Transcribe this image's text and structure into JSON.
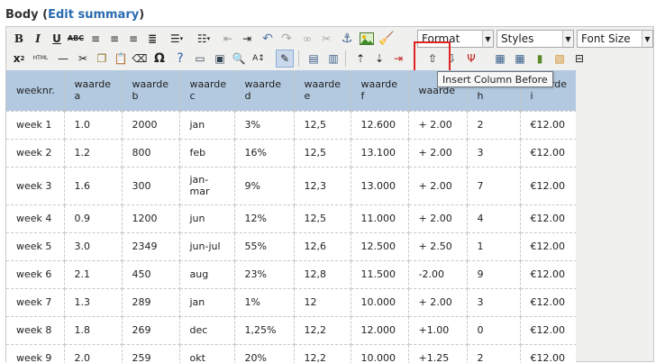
{
  "field": {
    "label": "Body",
    "open_paren": " (",
    "link": "Edit summary",
    "close_paren": ")"
  },
  "toolbar": {
    "format_value": "Format",
    "styles_value": "Styles",
    "fontsize_value": "Font Size",
    "tooltip": "Insert Column Before",
    "highlight_color": "#e02222"
  },
  "table": {
    "headers": [
      [
        "weeknr.",
        ""
      ],
      [
        "waarde",
        "a"
      ],
      [
        "waarde",
        "b"
      ],
      [
        "waarde",
        "c"
      ],
      [
        "waarde",
        "d"
      ],
      [
        "waarde",
        "e"
      ],
      [
        "waarde",
        "f"
      ],
      [
        "waarde",
        ""
      ],
      [
        "",
        "h"
      ],
      [
        "waarde",
        "i"
      ]
    ],
    "rows": [
      [
        "week 1",
        "1.0",
        "2000",
        "jan",
        "3%",
        "12,5",
        "12.600",
        "+ 2.00",
        "2",
        "€12.00"
      ],
      [
        "week 2",
        "1.2",
        "800",
        "feb",
        "16%",
        "12,5",
        "13.100",
        "+ 2.00",
        "3",
        "€12.00"
      ],
      [
        "week 3",
        "1.6",
        "300",
        "jan-\nmar",
        "9%",
        "12,3",
        "13.000",
        "+ 2.00",
        "7",
        "€12.00"
      ],
      [
        "week 4",
        "0.9",
        "1200",
        "jun",
        "12%",
        "12,5",
        "11.000",
        "+ 2.00",
        "4",
        "€12.00"
      ],
      [
        "week 5",
        "3.0",
        "2349",
        "jun-jul",
        "55%",
        "12,6",
        "12.500",
        "+ 2.50",
        "1",
        "€12.00"
      ],
      [
        "week 6",
        "2.1",
        "450",
        "aug",
        "23%",
        "12,8",
        "11.500",
        "-2.00",
        "9",
        "€12.00"
      ],
      [
        "week 7",
        "1.3",
        "289",
        "jan",
        "1%",
        "12",
        "10.000",
        "+ 2.00",
        "3",
        "€12.00"
      ],
      [
        "week 8",
        "1.8",
        "269",
        "dec",
        "1,25%",
        "12,2",
        "12.000",
        "+1.00",
        "0",
        "€12.00"
      ],
      [
        "week 9",
        "2.0",
        "259",
        "okt",
        "20%",
        "12,2",
        "10.000",
        "+1.25",
        "2",
        "€12.00"
      ]
    ]
  }
}
